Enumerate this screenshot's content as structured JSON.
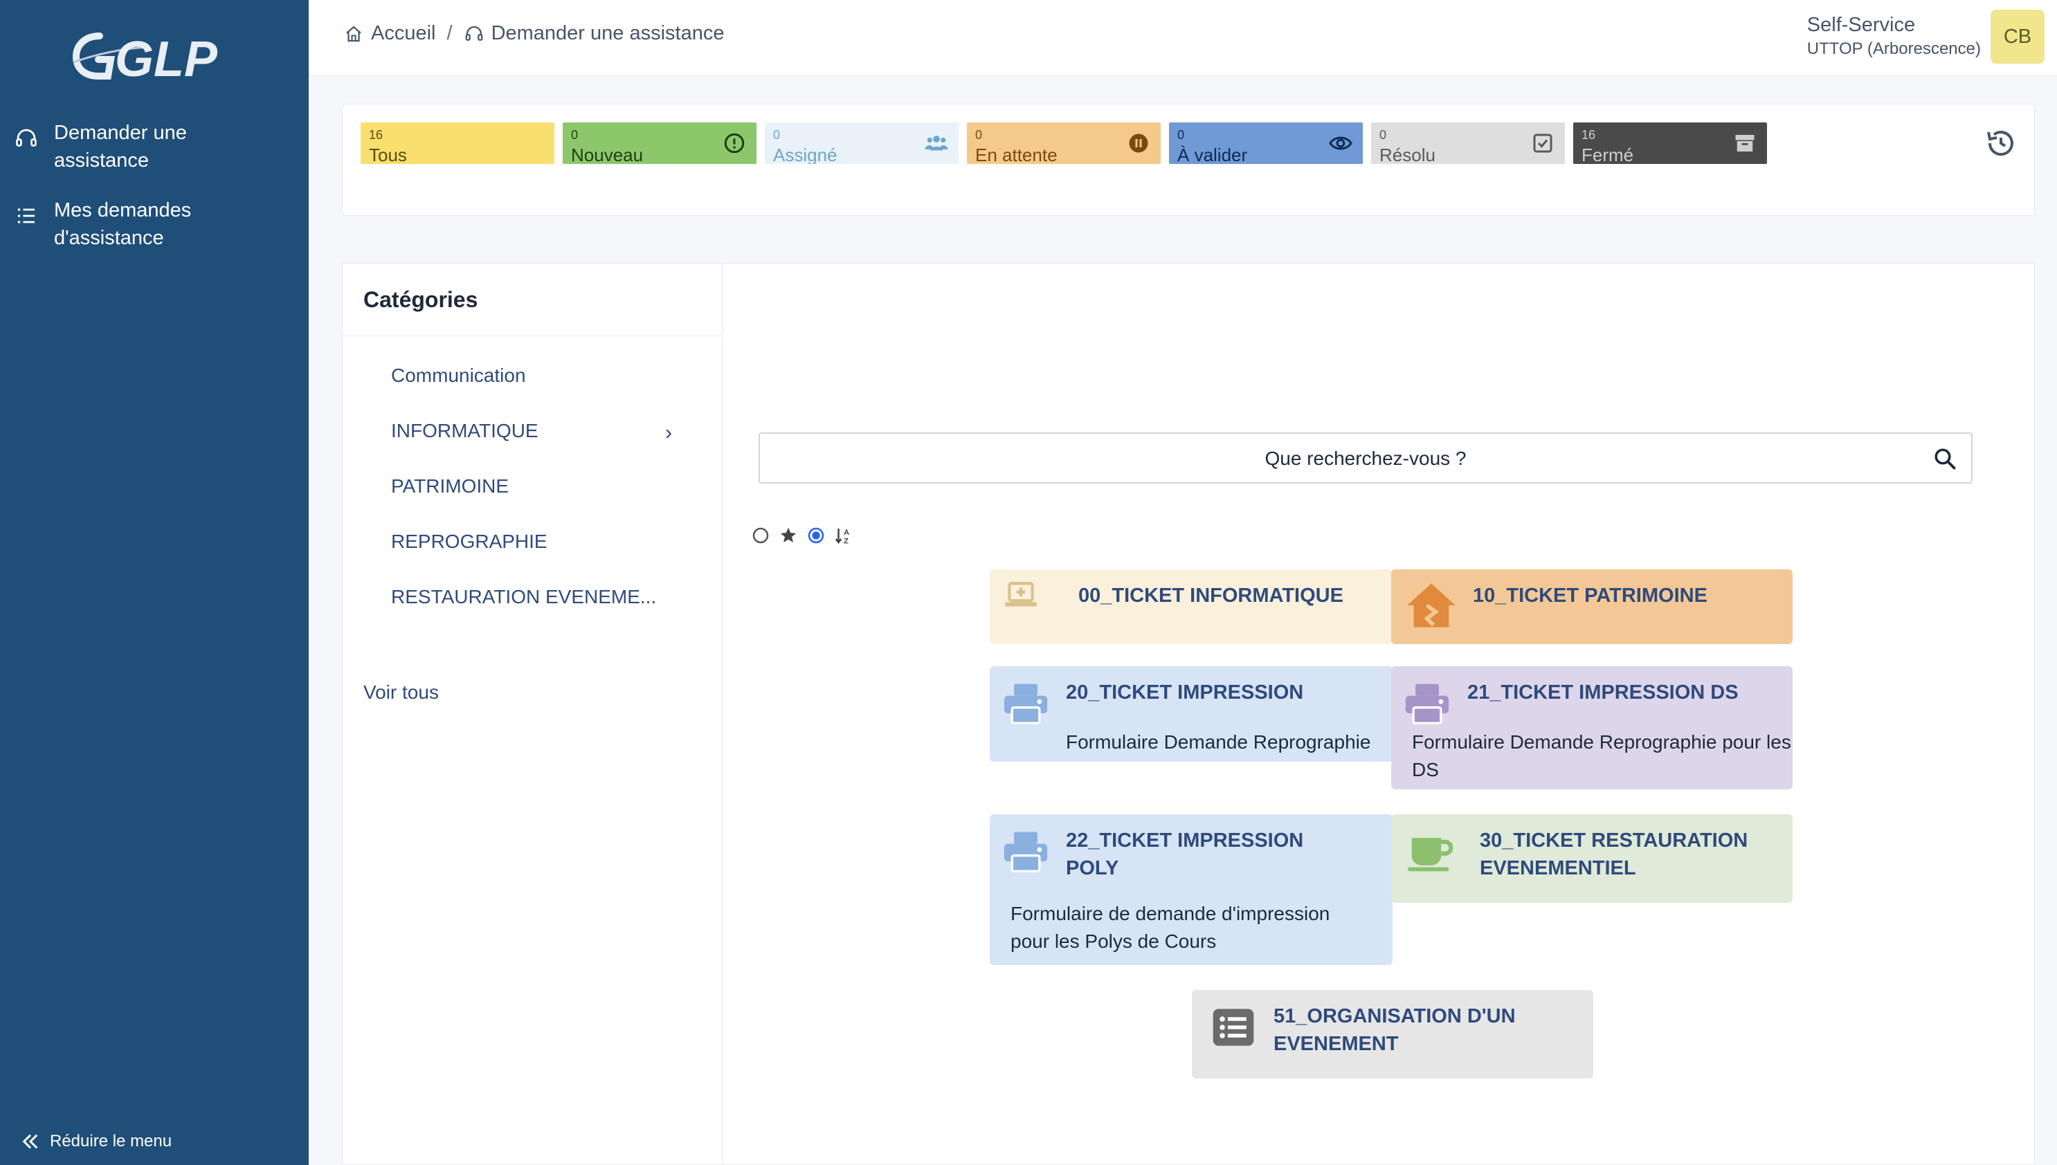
{
  "sidebar": {
    "logo_text": "GLPI",
    "items": [
      {
        "label": "Demander une assistance",
        "icon": "headset-icon"
      },
      {
        "label": "Mes demandes d'assistance",
        "icon": "list-icon"
      }
    ],
    "collapse_label": "Réduire le menu"
  },
  "header": {
    "breadcrumb": [
      {
        "label": "Accueil",
        "icon": "home-icon"
      },
      {
        "label": "Demander une assistance",
        "icon": "headset-icon"
      }
    ],
    "user_role": "Self-Service",
    "user_entity": "UTTOP (Arborescence)",
    "avatar_initials": "CB"
  },
  "status_tiles": [
    {
      "count": "16",
      "label": "Tous",
      "color": "#f9df6e",
      "text_color": "#5a4a10"
    },
    {
      "count": "0",
      "label": "Nouveau",
      "color": "#8cc86b",
      "text_color": "#1f3d12",
      "icon": "alert-circle-icon"
    },
    {
      "count": "0",
      "label": "Assigné",
      "color": "#e8f2f8",
      "text_color": "#6ea6c8",
      "icon": "users-icon"
    },
    {
      "count": "0",
      "label": "En attente",
      "color": "#f5c98a",
      "text_color": "#7a4a0a",
      "icon": "pause-icon"
    },
    {
      "count": "0",
      "label": "À valider",
      "color": "#6f9ad6",
      "text_color": "#0f2a52",
      "icon": "eye-icon"
    },
    {
      "count": "0",
      "label": "Résolu",
      "color": "#dedede",
      "text_color": "#5a5a5a",
      "icon": "check-square-icon"
    },
    {
      "count": "16",
      "label": "Fermé",
      "color": "#4a4a4a",
      "text_color": "#cfcfcf",
      "icon": "archive-icon"
    }
  ],
  "categories": {
    "title": "Catégories",
    "items": [
      "Communication",
      "INFORMATIQUE",
      "PATRIMOINE",
      "REPROGRAPHIE",
      "RESTAURATION EVENEME..."
    ],
    "see_all": "Voir tous"
  },
  "search": {
    "placeholder": "Que recherchez-vous ?"
  },
  "forms": [
    {
      "title": "00_TICKET INFORMATIQUE",
      "description": "",
      "icon": "laptop-medical-icon",
      "bg": "#faf0dc",
      "icon_color": "#d9c28a"
    },
    {
      "title": "10_TICKET PATRIMOINE",
      "description": "",
      "icon": "house-damage-icon",
      "bg": "#f4c896",
      "icon_color": "#e08a3c"
    },
    {
      "title": "20_TICKET IMPRESSION",
      "description": "Formulaire Demande Reprographie",
      "icon": "printer-icon",
      "bg": "#d6e4f5",
      "icon_color": "#8ab0e0"
    },
    {
      "title": "21_TICKET IMPRESSION DS",
      "description": "Formulaire Demande Reprographie pour les DS",
      "icon": "printer-icon",
      "bg": "#ddd6ea",
      "icon_color": "#a694c8"
    },
    {
      "title": "22_TICKET IMPRESSION POLY",
      "description": "Formulaire de demande d'impression pour les Polys de Cours",
      "icon": "printer-icon",
      "bg": "#d6e4f5",
      "icon_color": "#8ab0e0"
    },
    {
      "title": "30_TICKET RESTAURATION EVENEMENTIEL",
      "description": "",
      "icon": "coffee-cup-icon",
      "bg": "#dfead8",
      "icon_color": "#8cbf6e"
    },
    {
      "title": "51_ORGANISATION D'UN EVENEMENT",
      "description": "",
      "icon": "list-box-icon",
      "bg": "#e6e6e6",
      "icon_color": "#6b6b6b"
    }
  ]
}
